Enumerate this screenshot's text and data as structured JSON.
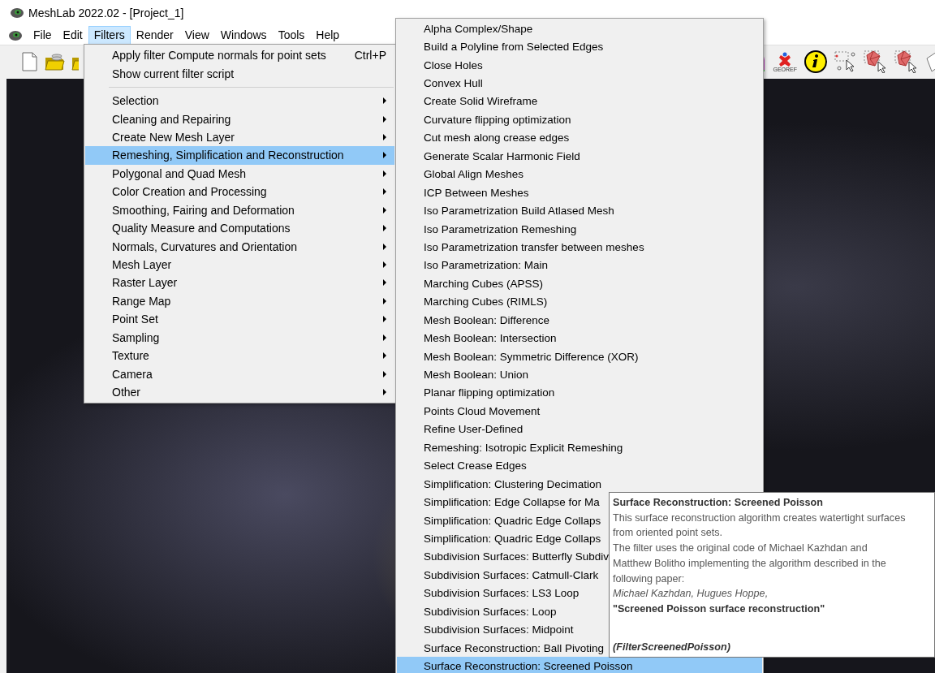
{
  "window": {
    "title": "MeshLab 2022.02 - [Project_1]"
  },
  "menu_bar": [
    {
      "label": "File",
      "selected": false
    },
    {
      "label": "Edit",
      "selected": false
    },
    {
      "label": "Filters",
      "selected": true
    },
    {
      "label": "Render",
      "selected": false
    },
    {
      "label": "View",
      "selected": false
    },
    {
      "label": "Windows",
      "selected": false
    },
    {
      "label": "Tools",
      "selected": false
    },
    {
      "label": "Help",
      "selected": false
    }
  ],
  "toolbar": {
    "georef_label": "GEOREF"
  },
  "filters_menu": {
    "items": [
      {
        "kind": "command",
        "label": "Apply filter Compute normals for point sets",
        "shortcut": "Ctrl+P",
        "selected": false
      },
      {
        "kind": "command",
        "label": "Show current filter script",
        "selected": false
      },
      {
        "kind": "separator"
      },
      {
        "kind": "submenu",
        "label": "Selection",
        "selected": false
      },
      {
        "kind": "submenu",
        "label": "Cleaning and Repairing",
        "selected": false
      },
      {
        "kind": "submenu",
        "label": "Create New Mesh Layer",
        "selected": false
      },
      {
        "kind": "submenu",
        "label": "Remeshing, Simplification and Reconstruction",
        "selected": true
      },
      {
        "kind": "submenu",
        "label": "Polygonal and Quad Mesh",
        "selected": false
      },
      {
        "kind": "submenu",
        "label": "Color Creation and Processing",
        "selected": false
      },
      {
        "kind": "submenu",
        "label": "Smoothing, Fairing and Deformation",
        "selected": false
      },
      {
        "kind": "submenu",
        "label": "Quality Measure and Computations",
        "selected": false
      },
      {
        "kind": "submenu",
        "label": "Normals, Curvatures and Orientation",
        "selected": false
      },
      {
        "kind": "submenu",
        "label": "Mesh Layer",
        "selected": false
      },
      {
        "kind": "submenu",
        "label": "Raster Layer",
        "selected": false
      },
      {
        "kind": "submenu",
        "label": "Range Map",
        "selected": false
      },
      {
        "kind": "submenu",
        "label": "Point Set",
        "selected": false
      },
      {
        "kind": "submenu",
        "label": "Sampling",
        "selected": false
      },
      {
        "kind": "submenu",
        "label": "Texture",
        "selected": false
      },
      {
        "kind": "submenu",
        "label": "Camera",
        "selected": false
      },
      {
        "kind": "submenu",
        "label": "Other",
        "selected": false
      }
    ]
  },
  "submenu": {
    "items": [
      {
        "label": "Alpha Complex/Shape",
        "selected": false
      },
      {
        "label": "Build a Polyline from Selected Edges",
        "selected": false
      },
      {
        "label": "Close Holes",
        "selected": false
      },
      {
        "label": "Convex Hull",
        "selected": false
      },
      {
        "label": "Create Solid Wireframe",
        "selected": false
      },
      {
        "label": "Curvature flipping optimization",
        "selected": false
      },
      {
        "label": "Cut mesh along crease edges",
        "selected": false
      },
      {
        "label": "Generate Scalar Harmonic Field",
        "selected": false
      },
      {
        "label": "Global Align Meshes",
        "selected": false
      },
      {
        "label": "ICP Between Meshes",
        "selected": false
      },
      {
        "label": "Iso Parametrization Build Atlased Mesh",
        "selected": false
      },
      {
        "label": "Iso Parametrization Remeshing",
        "selected": false
      },
      {
        "label": "Iso Parametrization transfer between meshes",
        "selected": false
      },
      {
        "label": "Iso Parametrization: Main",
        "selected": false
      },
      {
        "label": "Marching Cubes (APSS)",
        "selected": false
      },
      {
        "label": "Marching Cubes (RIMLS)",
        "selected": false
      },
      {
        "label": "Mesh Boolean: Difference",
        "selected": false
      },
      {
        "label": "Mesh Boolean: Intersection",
        "selected": false
      },
      {
        "label": "Mesh Boolean: Symmetric Difference (XOR)",
        "selected": false
      },
      {
        "label": "Mesh Boolean: Union",
        "selected": false
      },
      {
        "label": "Planar flipping optimization",
        "selected": false
      },
      {
        "label": "Points Cloud Movement",
        "selected": false
      },
      {
        "label": "Refine User-Defined",
        "selected": false
      },
      {
        "label": "Remeshing: Isotropic Explicit Remeshing",
        "selected": false
      },
      {
        "label": "Select Crease Edges",
        "selected": false
      },
      {
        "label": "Simplification: Clustering Decimation",
        "selected": false
      },
      {
        "label": "Simplification: Edge Collapse for Ma",
        "selected": false
      },
      {
        "label": "Simplification: Quadric Edge Collaps",
        "selected": false
      },
      {
        "label": "Simplification: Quadric Edge Collaps",
        "selected": false
      },
      {
        "label": "Subdivision Surfaces: Butterfly Subdiv",
        "selected": false
      },
      {
        "label": "Subdivision Surfaces: Catmull-Clark",
        "selected": false
      },
      {
        "label": "Subdivision Surfaces: LS3 Loop",
        "selected": false
      },
      {
        "label": "Subdivision Surfaces: Loop",
        "selected": false
      },
      {
        "label": "Subdivision Surfaces: Midpoint",
        "selected": false
      },
      {
        "label": "Surface Reconstruction: Ball Pivoting",
        "selected": false
      },
      {
        "label": "Surface Reconstruction: Screened Poisson",
        "selected": true
      }
    ]
  },
  "tooltip": {
    "blocks": [
      {
        "kind": "heading",
        "text": "Surface Reconstruction: Screened Poisson"
      },
      {
        "kind": "plain",
        "text": "This surface reconstruction algorithm creates watertight surfaces"
      },
      {
        "kind": "plain",
        "text": "from oriented point sets."
      },
      {
        "kind": "plain",
        "text": "The filter uses the original code of Michael Kazhdan and"
      },
      {
        "kind": "plain",
        "text": "Matthew Bolitho implementing the algorithm described in the"
      },
      {
        "kind": "plain",
        "text": "following paper:"
      },
      {
        "kind": "italic",
        "text": "Michael Kazhdan, Hugues Hoppe,"
      },
      {
        "kind": "bold",
        "text": "\"Screened Poisson surface reconstruction\""
      },
      {
        "kind": "spacer"
      },
      {
        "kind": "bold_italic",
        "text": "(FilterScreenedPoisson)"
      }
    ]
  }
}
